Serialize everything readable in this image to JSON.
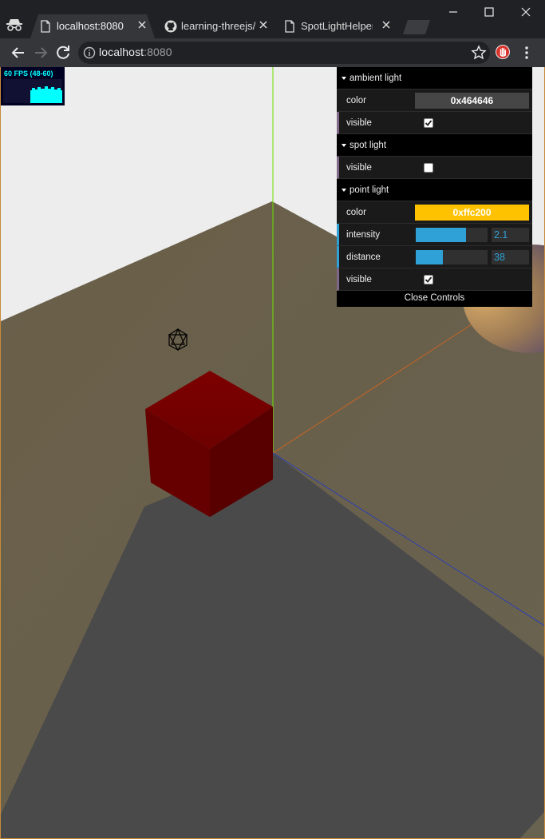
{
  "browser": {
    "tabs": [
      {
        "title": "localhost:8080",
        "active": true,
        "icon": "page-icon"
      },
      {
        "title": "learning-threejs/C",
        "active": false,
        "icon": "github-icon"
      },
      {
        "title": "SpotLightHelper",
        "active": false,
        "icon": "page-icon"
      }
    ],
    "url_host": "localhost",
    "url_port": ":8080"
  },
  "stats": {
    "fps_label": "60 FPS (48-60)",
    "fps_bar_level": 0.7
  },
  "gui": {
    "ambient_folder": "ambient light",
    "ambient_color_label": "color",
    "ambient_color_value": "0x464646",
    "ambient_visible_label": "visible",
    "ambient_visible": true,
    "spot_folder": "spot light",
    "spot_visible_label": "visible",
    "spot_visible": false,
    "point_folder": "point light",
    "point_color_label": "color",
    "point_color_value": "0xffc200",
    "point_intensity_label": "intensity",
    "point_intensity_value": "2.1",
    "point_intensity_fraction": 0.7,
    "point_distance_label": "distance",
    "point_distance_value": "38",
    "point_distance_fraction": 0.38,
    "point_visible_label": "visible",
    "point_visible": true,
    "close_label": "Close Controls"
  },
  "colors": {
    "ambient_swatch": "#464646",
    "point_swatch": "#ffc200",
    "slider_accent": "#2fa1d6",
    "plane": "#6b604a",
    "cube": "#7a0000"
  }
}
